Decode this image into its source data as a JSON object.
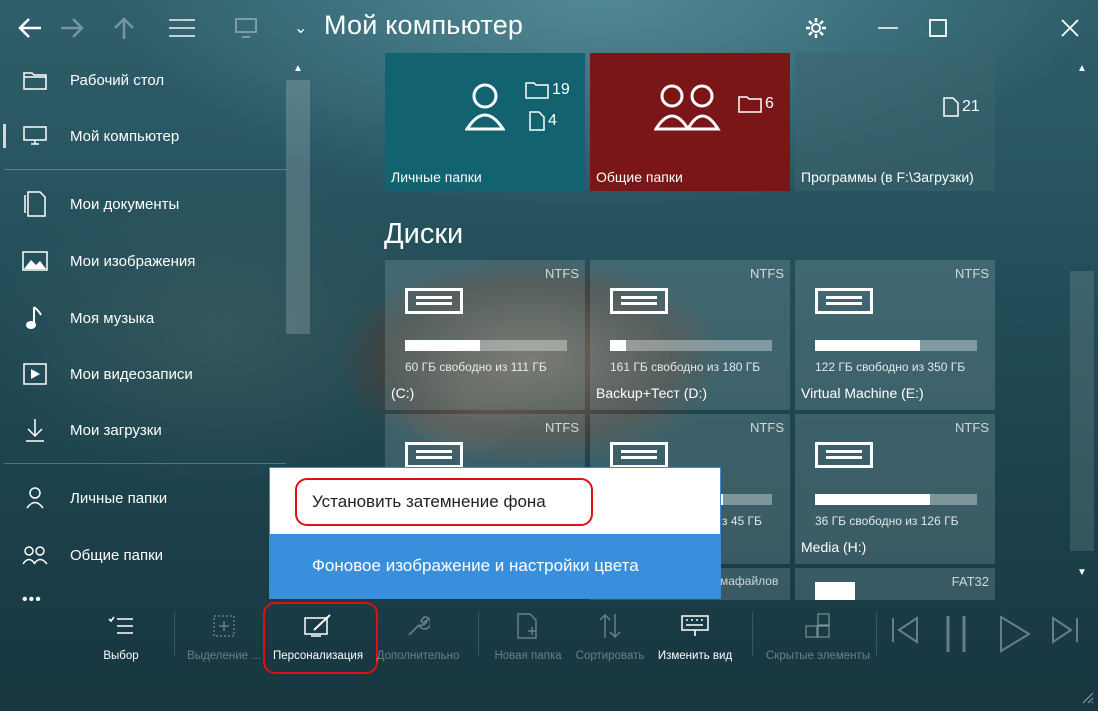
{
  "window": {
    "title": "Мой компьютер"
  },
  "sidebar": {
    "items": [
      {
        "label": "Рабочий стол",
        "icon": "folder-icon"
      },
      {
        "label": "Мой компьютер",
        "icon": "monitor-icon"
      },
      {
        "label": "Мои документы",
        "icon": "documents-icon"
      },
      {
        "label": "Мои изображения",
        "icon": "image-icon"
      },
      {
        "label": "Моя музыка",
        "icon": "music-note-icon"
      },
      {
        "label": "Мои видеозаписи",
        "icon": "video-icon"
      },
      {
        "label": "Мои загрузки",
        "icon": "download-icon"
      },
      {
        "label": "Личные папки",
        "icon": "person-icon"
      },
      {
        "label": "Общие папки",
        "icon": "people-icon"
      }
    ],
    "more": "•••"
  },
  "tiles": {
    "personal": {
      "label": "Личные папки",
      "folders": "19",
      "files": "4"
    },
    "shared": {
      "label": "Общие папки",
      "folders": "6"
    },
    "programs": {
      "label": "Программы (в F:\\Загрузки)",
      "files": "21"
    }
  },
  "disks_title": "Диски",
  "disks": [
    {
      "fs": "NTFS",
      "free_text": "60 ГБ свободно из 111 ГБ",
      "name": "(C:)",
      "used_fraction": 0.46
    },
    {
      "fs": "NTFS",
      "free_text": "161 ГБ свободно из 180 ГБ",
      "name": "Backup+Тест (D:)",
      "used_fraction": 0.1
    },
    {
      "fs": "NTFS",
      "free_text": "122 ГБ свободно из 350 ГБ",
      "name": "Virtual Machine (E:)",
      "used_fraction": 0.65
    },
    {
      "fs": "NTFS",
      "free_text": "",
      "name": "",
      "used_fraction": 0.3
    },
    {
      "fs": "NTFS",
      "free_text": "з 45 ГБ",
      "name": "",
      "used_fraction": 0.7
    },
    {
      "fs": "NTFS",
      "free_text": "36 ГБ свободно из 126 ГБ",
      "name": "Media (H:)",
      "used_fraction": 0.71
    }
  ],
  "partial_row": {
    "left_text": "мафайлов",
    "fs": "FAT32"
  },
  "menu": {
    "item1": "Установить затемнение фона",
    "item2": "Фоновое изображение и настройки цвета"
  },
  "commands": [
    {
      "label": "Выбор",
      "enabled": true
    },
    {
      "label": "Выделение ...",
      "enabled": false
    },
    {
      "label": "Персонализация",
      "enabled": true
    },
    {
      "label": "Дополнительно",
      "enabled": false
    },
    {
      "label": "Новая папка",
      "enabled": false
    },
    {
      "label": "Сортировать",
      "enabled": false
    },
    {
      "label": "Изменить вид",
      "enabled": true
    },
    {
      "label": "Скрытые элементы",
      "enabled": false
    }
  ],
  "colors": {
    "highlight_red": "#e01010",
    "menu_accent": "#3a8fdc",
    "shared_tile": "#7a1518",
    "personal_tile": "#136270"
  }
}
